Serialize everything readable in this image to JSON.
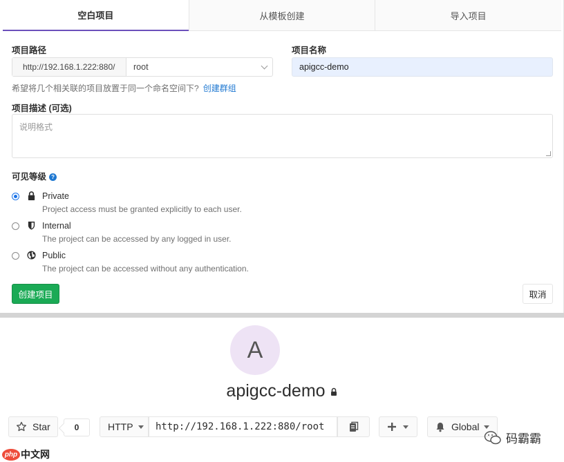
{
  "tabs": [
    {
      "label": "空白项目",
      "active": true
    },
    {
      "label": "从模板创建",
      "active": false
    },
    {
      "label": "导入项目",
      "active": false
    }
  ],
  "form": {
    "path_label": "项目路径",
    "path_prefix": "http://192.168.1.222:880/",
    "namespace_value": "root",
    "name_label": "项目名称",
    "name_value": "apigcc-demo",
    "group_hint": "希望将几个相关联的项目放置于同一个命名空间下?",
    "group_link": "创建群组",
    "desc_label": "项目描述 (可选)",
    "desc_placeholder": "说明格式",
    "visibility_label": "可见等级",
    "visibility_help_icon": "question-circle-icon",
    "visibility_options": [
      {
        "title": "Private",
        "desc": "Project access must be granted explicitly to each user.",
        "icon": "lock-icon",
        "selected": true
      },
      {
        "title": "Internal",
        "desc": "The project can be accessed by any logged in user.",
        "icon": "shield-icon",
        "selected": false
      },
      {
        "title": "Public",
        "desc": "The project can be accessed without any authentication.",
        "icon": "globe-icon",
        "selected": false
      }
    ],
    "create_button": "创建项目",
    "cancel_button": "取消"
  },
  "project": {
    "avatar_letter": "A",
    "name": "apigcc-demo",
    "star_label": "Star",
    "star_count": "0",
    "protocol": "HTTP",
    "clone_url": "http://192.168.1.222:880/root",
    "notification_label": "Global"
  },
  "watermarks": {
    "wechat_name": "码霸霸",
    "php_badge": "php",
    "php_site": "中文网"
  },
  "colors": {
    "accent": "#6b4fbb",
    "create_green": "#1aaa55",
    "link_blue": "#1f78d1",
    "name_input_bg": "#e8f0fe",
    "avatar_bg": "#eee3f5"
  }
}
